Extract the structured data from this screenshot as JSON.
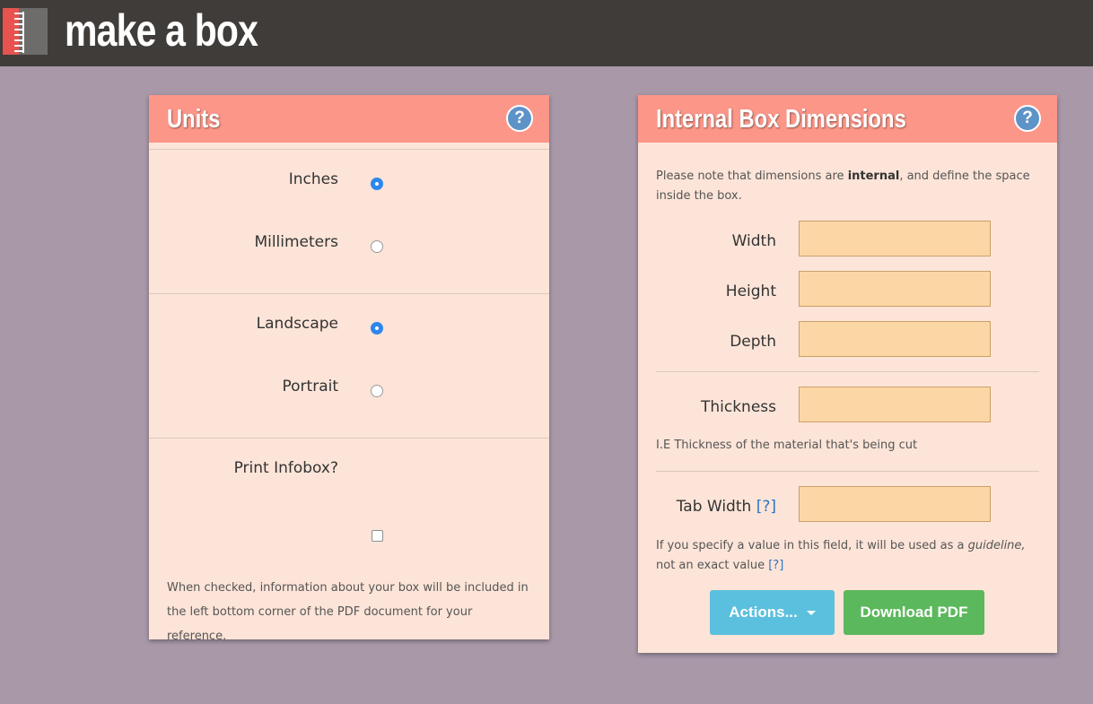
{
  "app": {
    "title": "make a box",
    "logo_icon": "notebook-icon"
  },
  "units_panel": {
    "title": "Units",
    "help_icon": "?",
    "units": {
      "options": [
        {
          "label": "Inches",
          "checked": true
        },
        {
          "label": "Millimeters",
          "checked": false
        }
      ]
    },
    "orientation": {
      "options": [
        {
          "label": "Landscape",
          "checked": true
        },
        {
          "label": "Portrait",
          "checked": false
        }
      ]
    },
    "infobox": {
      "label": "Print Infobox?",
      "checked": false,
      "description": "When checked, information about your box will be included in the left bottom corner of the PDF document for your reference."
    }
  },
  "dimensions_panel": {
    "title": "Internal Box Dimensions",
    "help_icon": "?",
    "note_prefix": "Please note that dimensions are ",
    "note_bold": "internal",
    "note_suffix": ", and define the space inside the box.",
    "fields": [
      {
        "label": "Width",
        "value": ""
      },
      {
        "label": "Height",
        "value": ""
      },
      {
        "label": "Depth",
        "value": ""
      }
    ],
    "thickness": {
      "label": "Thickness",
      "value": "",
      "hint": "I.E Thickness of the material that's being cut"
    },
    "tab_width": {
      "label": "Tab Width",
      "help_link": "[?]",
      "value": "",
      "hint_prefix": "If you specify a value in this field, it will be used as a ",
      "hint_italic": "guideline,",
      "hint_suffix": " not an exact value ",
      "hint_link": "[?]"
    },
    "actions_button": "Actions...",
    "download_button": "Download PDF"
  },
  "colors": {
    "background": "#a898a8",
    "header": "#403c3a",
    "panel_header": "#fb9688",
    "panel_body": "#fde4d8",
    "input_fill": "#fdd6a6",
    "radio_checked": "#2f86ec",
    "actions_button": "#5bc0de",
    "download_button": "#5cb85c"
  }
}
